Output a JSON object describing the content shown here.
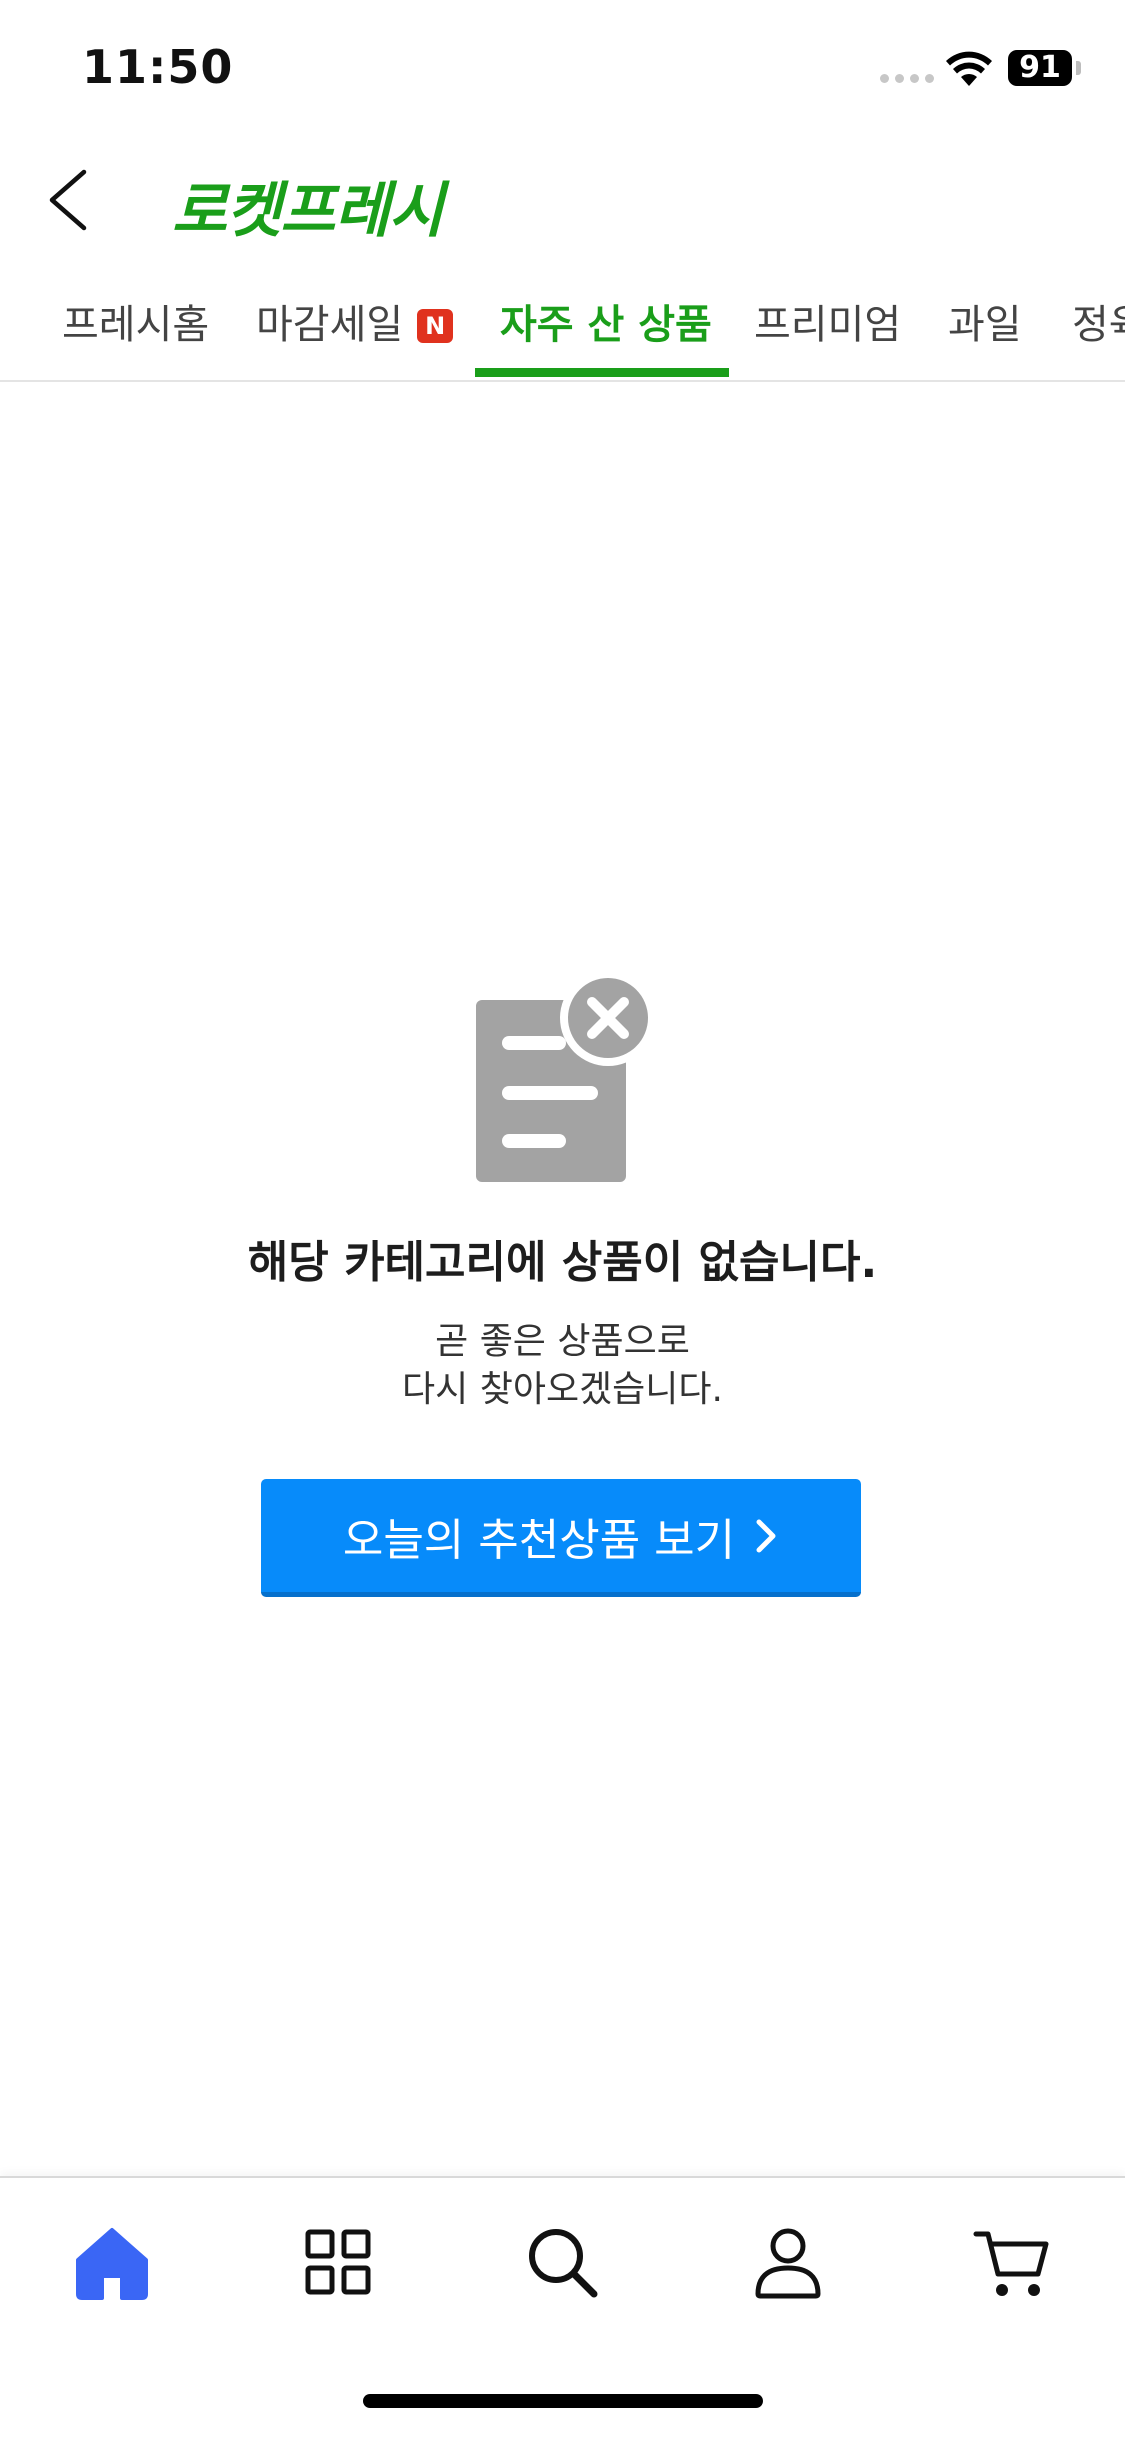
{
  "status_bar": {
    "time": "11:50",
    "battery": "91"
  },
  "header": {
    "title": "로켓프레시",
    "back_icon": "chevron-left-icon"
  },
  "tabs": [
    {
      "label": "프레시홈",
      "active": false
    },
    {
      "label": "마감세일",
      "active": false,
      "badge": "N"
    },
    {
      "label": "자주 산 상품",
      "active": true
    },
    {
      "label": "프리미엄",
      "active": false
    },
    {
      "label": "과일",
      "active": false
    },
    {
      "label": "정육",
      "active": false
    }
  ],
  "empty_state": {
    "icon": "document-error-icon",
    "title": "해당 카테고리에 상품이 없습니다.",
    "line1": "곧 좋은 상품으로",
    "line2": "다시 찾아오겠습니다.",
    "button_label": "오늘의 추천상품 보기"
  },
  "bottom_nav": [
    {
      "icon": "home-icon",
      "active": true
    },
    {
      "icon": "grid-icon",
      "active": false
    },
    {
      "icon": "search-icon",
      "active": false
    },
    {
      "icon": "user-icon",
      "active": false
    },
    {
      "icon": "cart-icon",
      "active": false
    }
  ],
  "colors": {
    "brand_green": "#1a9e1a",
    "button_blue": "#078bfa",
    "nav_active": "#3a66f5",
    "badge_red": "#e0321e",
    "icon_gray": "#a3a3a3"
  }
}
